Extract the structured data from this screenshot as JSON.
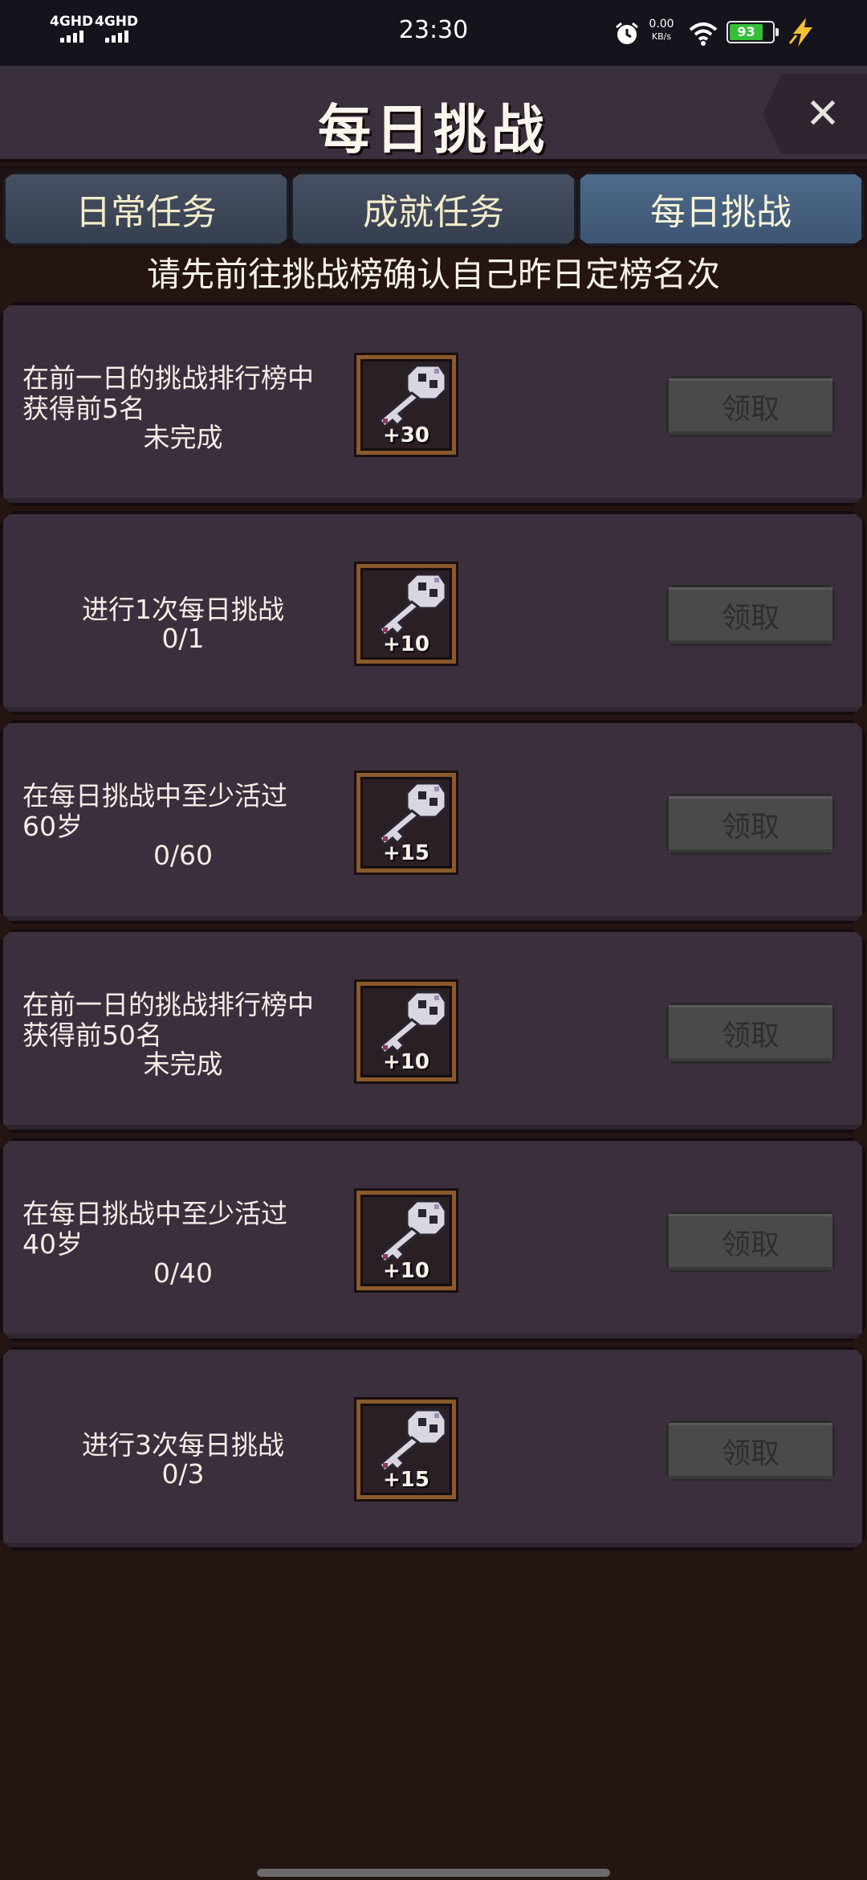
{
  "status_bar": {
    "signal1": "4GHD",
    "signal2": "4GHD",
    "time": "23:30",
    "speed_value": "0.00",
    "speed_unit": "KB/s",
    "battery": "93"
  },
  "header": {
    "title": "每日挑战",
    "close_symbol": "✕"
  },
  "tabs": [
    {
      "label": "日常任务",
      "active": false
    },
    {
      "label": "成就任务",
      "active": false
    },
    {
      "label": "每日挑战",
      "active": true
    }
  ],
  "banner": "请先前往挑战榜确认自己昨日定榜名次",
  "tasks": [
    {
      "line1": "在前一日的挑战排行榜中",
      "line2": "获得前5名",
      "progress": "未完成",
      "reward": "+30",
      "button": "领取"
    },
    {
      "line1": "进行1次每日挑战",
      "line2": "",
      "progress": "0/1",
      "reward": "+10",
      "button": "领取"
    },
    {
      "line1": "在每日挑战中至少活过",
      "line2": "60岁",
      "progress": "0/60",
      "reward": "+15",
      "button": "领取"
    },
    {
      "line1": "在前一日的挑战排行榜中",
      "line2": "获得前50名",
      "progress": "未完成",
      "reward": "+10",
      "button": "领取"
    },
    {
      "line1": "在每日挑战中至少活过",
      "line2": "40岁",
      "progress": "0/40",
      "reward": "+10",
      "button": "领取"
    },
    {
      "line1": "进行3次每日挑战",
      "line2": "",
      "progress": "0/3",
      "reward": "+15",
      "button": "领取"
    }
  ],
  "icons": {
    "reward": "silver-key-icon",
    "close": "close-icon",
    "alarm": "alarm-clock-icon",
    "wifi": "wifi-icon",
    "charge": "charging-bolt-icon"
  }
}
